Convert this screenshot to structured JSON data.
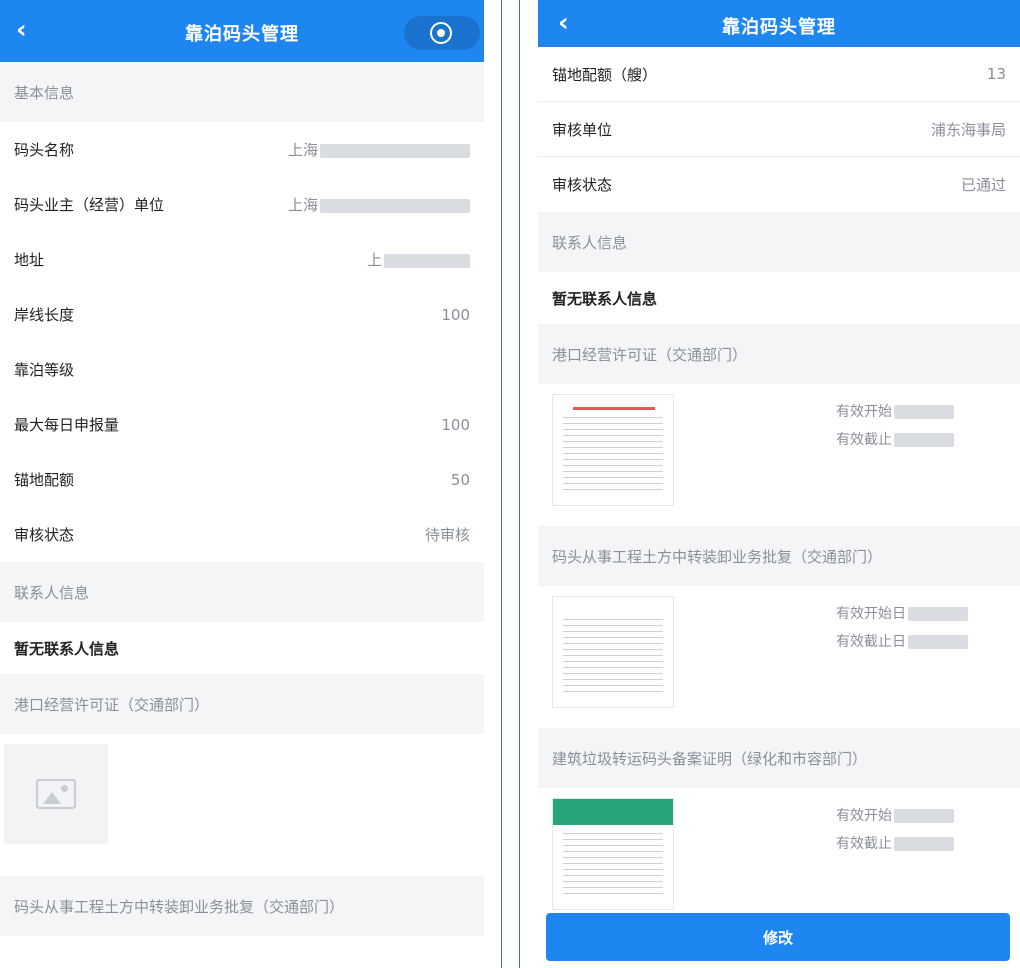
{
  "title": "靠泊码头管理",
  "left": {
    "sections": {
      "basic": "基本信息",
      "contacts": "联系人信息",
      "port_license": "港口经营许可证（交通部门）",
      "earthwork": "码头从事工程土方中转装卸业务批复（交通部门）"
    },
    "rows": [
      {
        "label": "码头名称",
        "value": "上海"
      },
      {
        "label": "码头业主（经营）单位",
        "value": "上海"
      },
      {
        "label": "地址",
        "value": "上"
      },
      {
        "label": "岸线长度",
        "value": "100"
      },
      {
        "label": "靠泊等级",
        "value": ""
      },
      {
        "label": "最大每日申报量",
        "value": "100"
      },
      {
        "label": "锚地配额",
        "value": "50"
      },
      {
        "label": "审核状态",
        "value": "待审核"
      }
    ],
    "no_contacts": "暂无联系人信息"
  },
  "right": {
    "rows": [
      {
        "label": "锚地配额（艘）",
        "value": "13"
      },
      {
        "label": "审核单位",
        "value": "浦东海事局"
      },
      {
        "label": "审核状态",
        "value": "已通过"
      }
    ],
    "sections": {
      "contacts": "联系人信息",
      "port_license": "港口经营许可证（交通部门）",
      "earthwork": "码头从事工程土方中转装卸业务批复（交通部门）",
      "construction_waste": "建筑垃圾转运码头备案证明（绿化和市容部门）"
    },
    "no_contacts": "暂无联系人信息",
    "certs": [
      {
        "start": "有效开始",
        "end": "有效截止"
      },
      {
        "start": "有效开始日",
        "end": "有效截止日"
      },
      {
        "start": "有效开始",
        "end": "有效截止"
      }
    ],
    "modify_button": "修改"
  }
}
